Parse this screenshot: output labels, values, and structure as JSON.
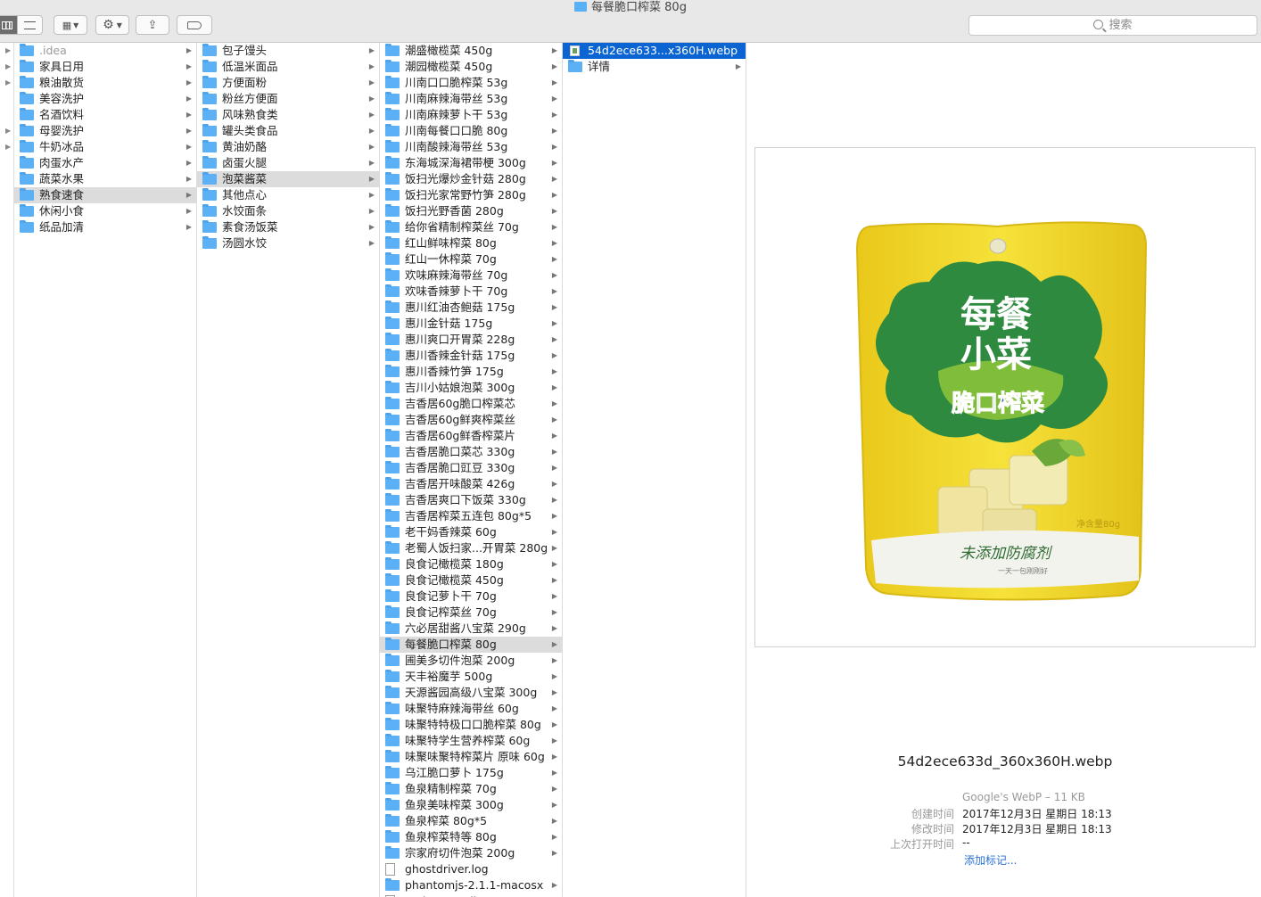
{
  "window": {
    "title": "每餐脆口榨菜 80g"
  },
  "toolbar": {
    "search_placeholder": "搜索"
  },
  "col1": [
    {
      "label": ".idea",
      "dim": true
    },
    {
      "label": "家具日用"
    },
    {
      "label": "粮油散货"
    },
    {
      "label": "美容洗护"
    },
    {
      "label": "名酒饮料"
    },
    {
      "label": "母婴洗护"
    },
    {
      "label": "牛奶冰品"
    },
    {
      "label": "肉蛋水产"
    },
    {
      "label": "蔬菜水果"
    },
    {
      "label": "熟食速食",
      "selected": true
    },
    {
      "label": "休闲小食"
    },
    {
      "label": "纸品加清"
    }
  ],
  "col2": [
    {
      "label": "包子馒头"
    },
    {
      "label": "低温米面品"
    },
    {
      "label": "方便面粉"
    },
    {
      "label": "粉丝方便面"
    },
    {
      "label": "风味熟食类"
    },
    {
      "label": "罐头类食品"
    },
    {
      "label": "黄油奶酪"
    },
    {
      "label": "卤蛋火腿"
    },
    {
      "label": "泡菜酱菜",
      "selected": true
    },
    {
      "label": "其他点心"
    },
    {
      "label": "水饺面条"
    },
    {
      "label": "素食汤饭菜"
    },
    {
      "label": "汤圆水饺"
    }
  ],
  "col3": [
    {
      "label": "潮盛橄榄菜 450g"
    },
    {
      "label": "潮园橄榄菜 450g"
    },
    {
      "label": "川南口口脆榨菜 53g"
    },
    {
      "label": "川南麻辣海带丝 53g"
    },
    {
      "label": "川南麻辣萝卜干 53g"
    },
    {
      "label": "川南每餐口口脆 80g"
    },
    {
      "label": "川南酸辣海带丝 53g"
    },
    {
      "label": "东海城深海裙带梗 300g"
    },
    {
      "label": "饭扫光爆炒金针菇 280g"
    },
    {
      "label": "饭扫光家常野竹笋 280g"
    },
    {
      "label": "饭扫光野香菌 280g"
    },
    {
      "label": "给你省精制榨菜丝 70g"
    },
    {
      "label": "红山鲜味榨菜 80g"
    },
    {
      "label": "红山一休榨菜 70g"
    },
    {
      "label": "欢味麻辣海带丝 70g"
    },
    {
      "label": "欢味香辣萝卜干 70g"
    },
    {
      "label": "惠川红油杏鲍菇 175g"
    },
    {
      "label": "惠川金针菇 175g"
    },
    {
      "label": "惠川爽口开胃菜 228g"
    },
    {
      "label": "惠川香辣金针菇 175g"
    },
    {
      "label": "惠川香辣竹笋 175g"
    },
    {
      "label": "吉川小姑娘泡菜 300g"
    },
    {
      "label": "吉香居60g脆口榨菜芯"
    },
    {
      "label": "吉香居60g鲜爽榨菜丝"
    },
    {
      "label": "吉香居60g鲜香榨菜片"
    },
    {
      "label": "吉香居脆口菜芯 330g"
    },
    {
      "label": "吉香居脆口豇豆 330g"
    },
    {
      "label": "吉香居开味酸菜 426g"
    },
    {
      "label": "吉香居爽口下饭菜 330g"
    },
    {
      "label": "吉香居榨菜五连包 80g*5"
    },
    {
      "label": "老干妈香辣菜 60g"
    },
    {
      "label": "老蜀人饭扫家...开胃菜 280g"
    },
    {
      "label": "良食记橄榄菜 180g"
    },
    {
      "label": "良食记橄榄菜 450g"
    },
    {
      "label": "良食记萝卜干 70g"
    },
    {
      "label": "良食记榨菜丝 70g"
    },
    {
      "label": "六必居甜酱八宝菜 290g"
    },
    {
      "label": "每餐脆口榨菜 80g",
      "selected": true
    },
    {
      "label": "圃美多切件泡菜 200g"
    },
    {
      "label": "天丰裕魔芋 500g"
    },
    {
      "label": "天源酱园高级八宝菜 300g"
    },
    {
      "label": "味聚特麻辣海带丝 60g"
    },
    {
      "label": "味聚特特极口口脆榨菜 80g"
    },
    {
      "label": "味聚特学生营养榨菜 60g"
    },
    {
      "label": "味聚味聚特榨菜片 原味 60g"
    },
    {
      "label": "乌江脆口萝卜 175g"
    },
    {
      "label": "鱼泉精制榨菜 70g"
    },
    {
      "label": "鱼泉美味榨菜 300g"
    },
    {
      "label": "鱼泉榨菜 80g*5"
    },
    {
      "label": "鱼泉榨菜特等 80g"
    },
    {
      "label": "宗家府切件泡菜 200g"
    },
    {
      "label": "ghostdriver.log",
      "type": "file"
    },
    {
      "label": "phantomjs-2.1.1-macosx"
    },
    {
      "label": "PythonDetail.py",
      "type": "file"
    }
  ],
  "col4": [
    {
      "label": "54d2ece633...x360H.webp",
      "type": "image",
      "active": true
    },
    {
      "label": "详情"
    }
  ],
  "preview": {
    "filename": "54d2ece633d_360x360H.webp",
    "kind": "Google's WebP – 11 KB",
    "created_label": "创建时间",
    "created": "2017年12月3日 星期日 18:13",
    "modified_label": "修改时间",
    "modified": "2017年12月3日 星期日 18:13",
    "opened_label": "上次打开时间",
    "opened": "--",
    "add_tags": "添加标记...",
    "bag_title_line1": "每餐",
    "bag_title_line2": "小菜",
    "bag_subtitle": "脆口榨菜",
    "bag_slogan": "未添加防腐剂",
    "bag_weight": "净含量80g",
    "bag_tagline": "一天一包刚刚好"
  },
  "colors": {
    "folder": "#5cb1f6",
    "selection": "#0a64d2",
    "bag_yellow": "#f2d82a",
    "bag_green": "#2e8a3e"
  }
}
